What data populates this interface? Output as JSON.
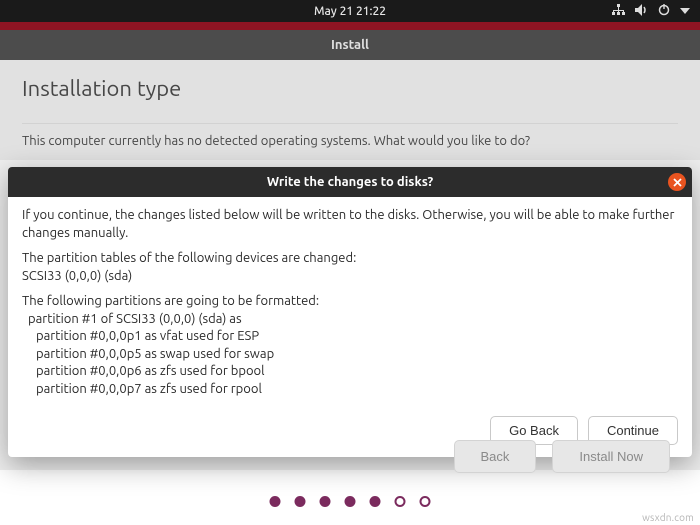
{
  "topbar": {
    "clock": "May 21  21:22"
  },
  "installer": {
    "window_title": "Install",
    "heading": "Installation type",
    "question": "This computer currently has no detected operating systems. What would you like to do?",
    "back_label": "Back",
    "install_now_label": "Install Now"
  },
  "dialog": {
    "title": "Write the changes to disks?",
    "intro": "If you continue, the changes listed below will be written to the disks. Otherwise, you will be able to make further changes manually.",
    "pt_heading": "The partition tables of the following devices are changed:",
    "pt_device": "SCSI33 (0,0,0) (sda)",
    "fmt_heading": "The following partitions are going to be formatted:",
    "fmt_device": "partition #1 of SCSI33 (0,0,0) (sda) as",
    "partitions": [
      "partition #0,0,0p1 as vfat used for ESP",
      "partition #0,0,0p5 as swap used for swap",
      "partition #0,0,0p6 as zfs used for bpool",
      "partition #0,0,0p7 as zfs used for rpool"
    ],
    "go_back_label": "Go Back",
    "continue_label": "Continue"
  },
  "progress": {
    "total": 7,
    "current": 5
  },
  "watermark": "wsxdn.com"
}
